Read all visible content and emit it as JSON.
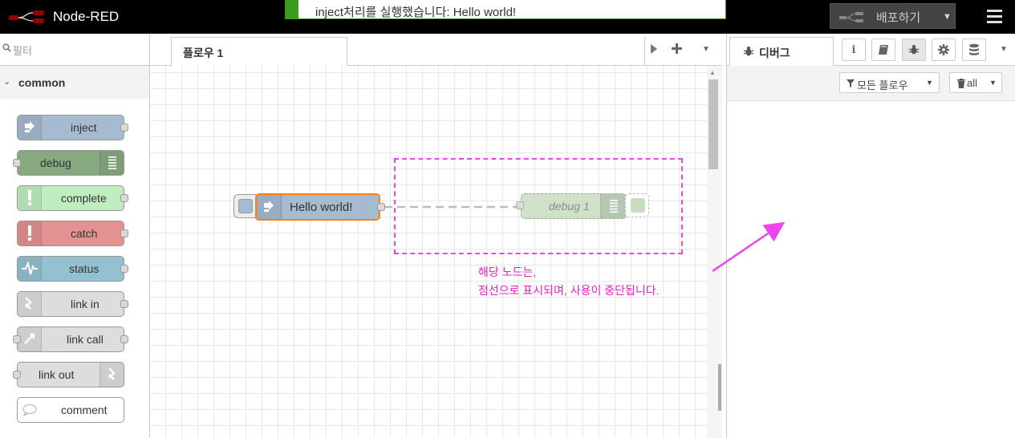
{
  "header": {
    "title": "Node-RED",
    "notification": "inject처리를 실행했습니다: Hello world!",
    "deploy_label": "배포하기"
  },
  "palette": {
    "search_placeholder": "필터",
    "category": "common",
    "nodes": [
      {
        "label": "inject",
        "color": "#a6bbcf",
        "icon": "arrow-right-icon"
      },
      {
        "label": "debug",
        "color": "#87a980",
        "icon": "list-icon"
      },
      {
        "label": "complete",
        "color": "#c0edc0",
        "icon": "exclamation-icon"
      },
      {
        "label": "catch",
        "color": "#e49191",
        "icon": "exclamation-icon"
      },
      {
        "label": "status",
        "color": "#94c1d0",
        "icon": "pulse-icon"
      },
      {
        "label": "link in",
        "color": "#dddddd",
        "icon": "link-in-icon"
      },
      {
        "label": "link call",
        "color": "#dddddd",
        "icon": "link-call-icon"
      },
      {
        "label": "link out",
        "color": "#dddddd",
        "icon": "link-out-icon"
      },
      {
        "label": "comment",
        "color": "#ffffff",
        "icon": "comment-icon"
      }
    ]
  },
  "workspace": {
    "tab_label": "플로우 1",
    "inject_node_label": "Hello world!",
    "debug_node_label": "debug 1",
    "annotation_line1": "해당 노드는,",
    "annotation_line2": "점선으로 표시되며, 사용이 중단됩니다."
  },
  "sidebar": {
    "tab_label": "디버그",
    "filter_label": "모든 플로우",
    "clear_label": "all"
  },
  "colors": {
    "selection": "#ff7f0e",
    "annotation": "#e620c6",
    "notification_accent": "#3c9a1e"
  }
}
